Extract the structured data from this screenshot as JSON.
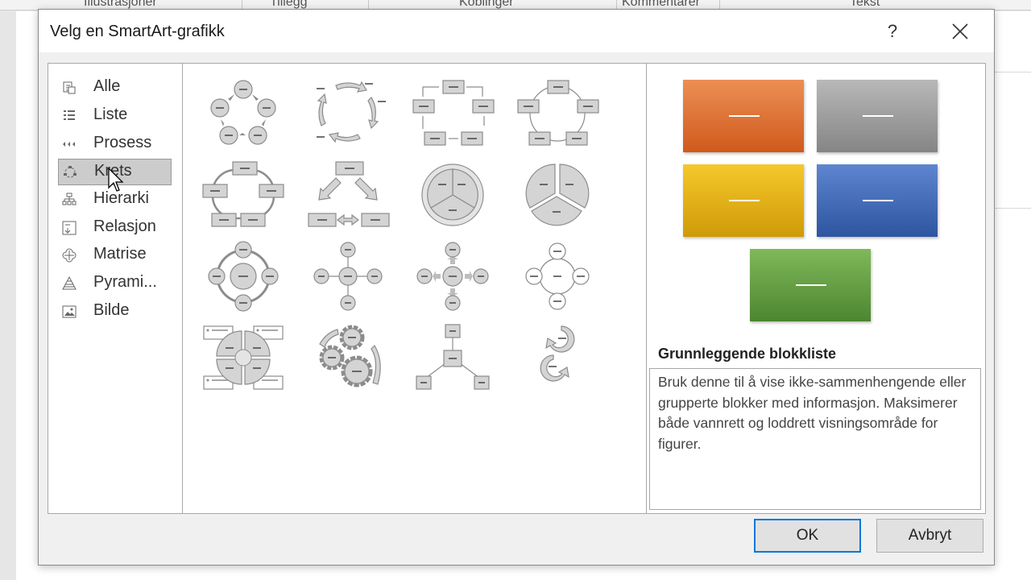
{
  "background": {
    "ribbon_labels": [
      "Illustrasjoner",
      "Tillegg",
      "Koblinger",
      "Kommentarer",
      "Tekst"
    ]
  },
  "dialog": {
    "title": "Velg en SmartArt-grafikk",
    "help_label": "?",
    "categories": [
      {
        "label": "Alle",
        "icon": "all-icon"
      },
      {
        "label": "Liste",
        "icon": "list-icon"
      },
      {
        "label": "Prosess",
        "icon": "process-icon"
      },
      {
        "label": "Krets",
        "icon": "cycle-icon",
        "selected": true
      },
      {
        "label": "Hierarki",
        "icon": "hierarchy-icon"
      },
      {
        "label": "Relasjon",
        "icon": "relationship-icon"
      },
      {
        "label": "Matrise",
        "icon": "matrix-icon"
      },
      {
        "label": "Pyrami...",
        "icon": "pyramid-icon"
      },
      {
        "label": "Bilde",
        "icon": "picture-icon"
      }
    ],
    "gallery_items": [
      "basic-cycle",
      "text-cycle",
      "block-cycle",
      "segmented-cycle",
      "nondirectional-cycle",
      "continuous-cycle",
      "multidirectional-cycle",
      "basic-pie",
      "radial-cycle",
      "basic-radial",
      "diverging-radial",
      "radial-cluster",
      "cycle-matrix",
      "gear",
      "radial-venn",
      "circular-arrows"
    ],
    "preview": {
      "title": "Grunnleggende blokkliste",
      "description": "Bruk denne til å vise ikke-sammenhengende eller grupperte blokker med informasjon. Maksimerer både vannrett og loddrett visningsområde for figurer.",
      "colors": [
        "#e06a2a",
        "#9a9a9a",
        "#e8ae10",
        "#3f6bb8",
        "#5e9c3f"
      ]
    },
    "buttons": {
      "ok": "OK",
      "cancel": "Avbryt"
    }
  }
}
